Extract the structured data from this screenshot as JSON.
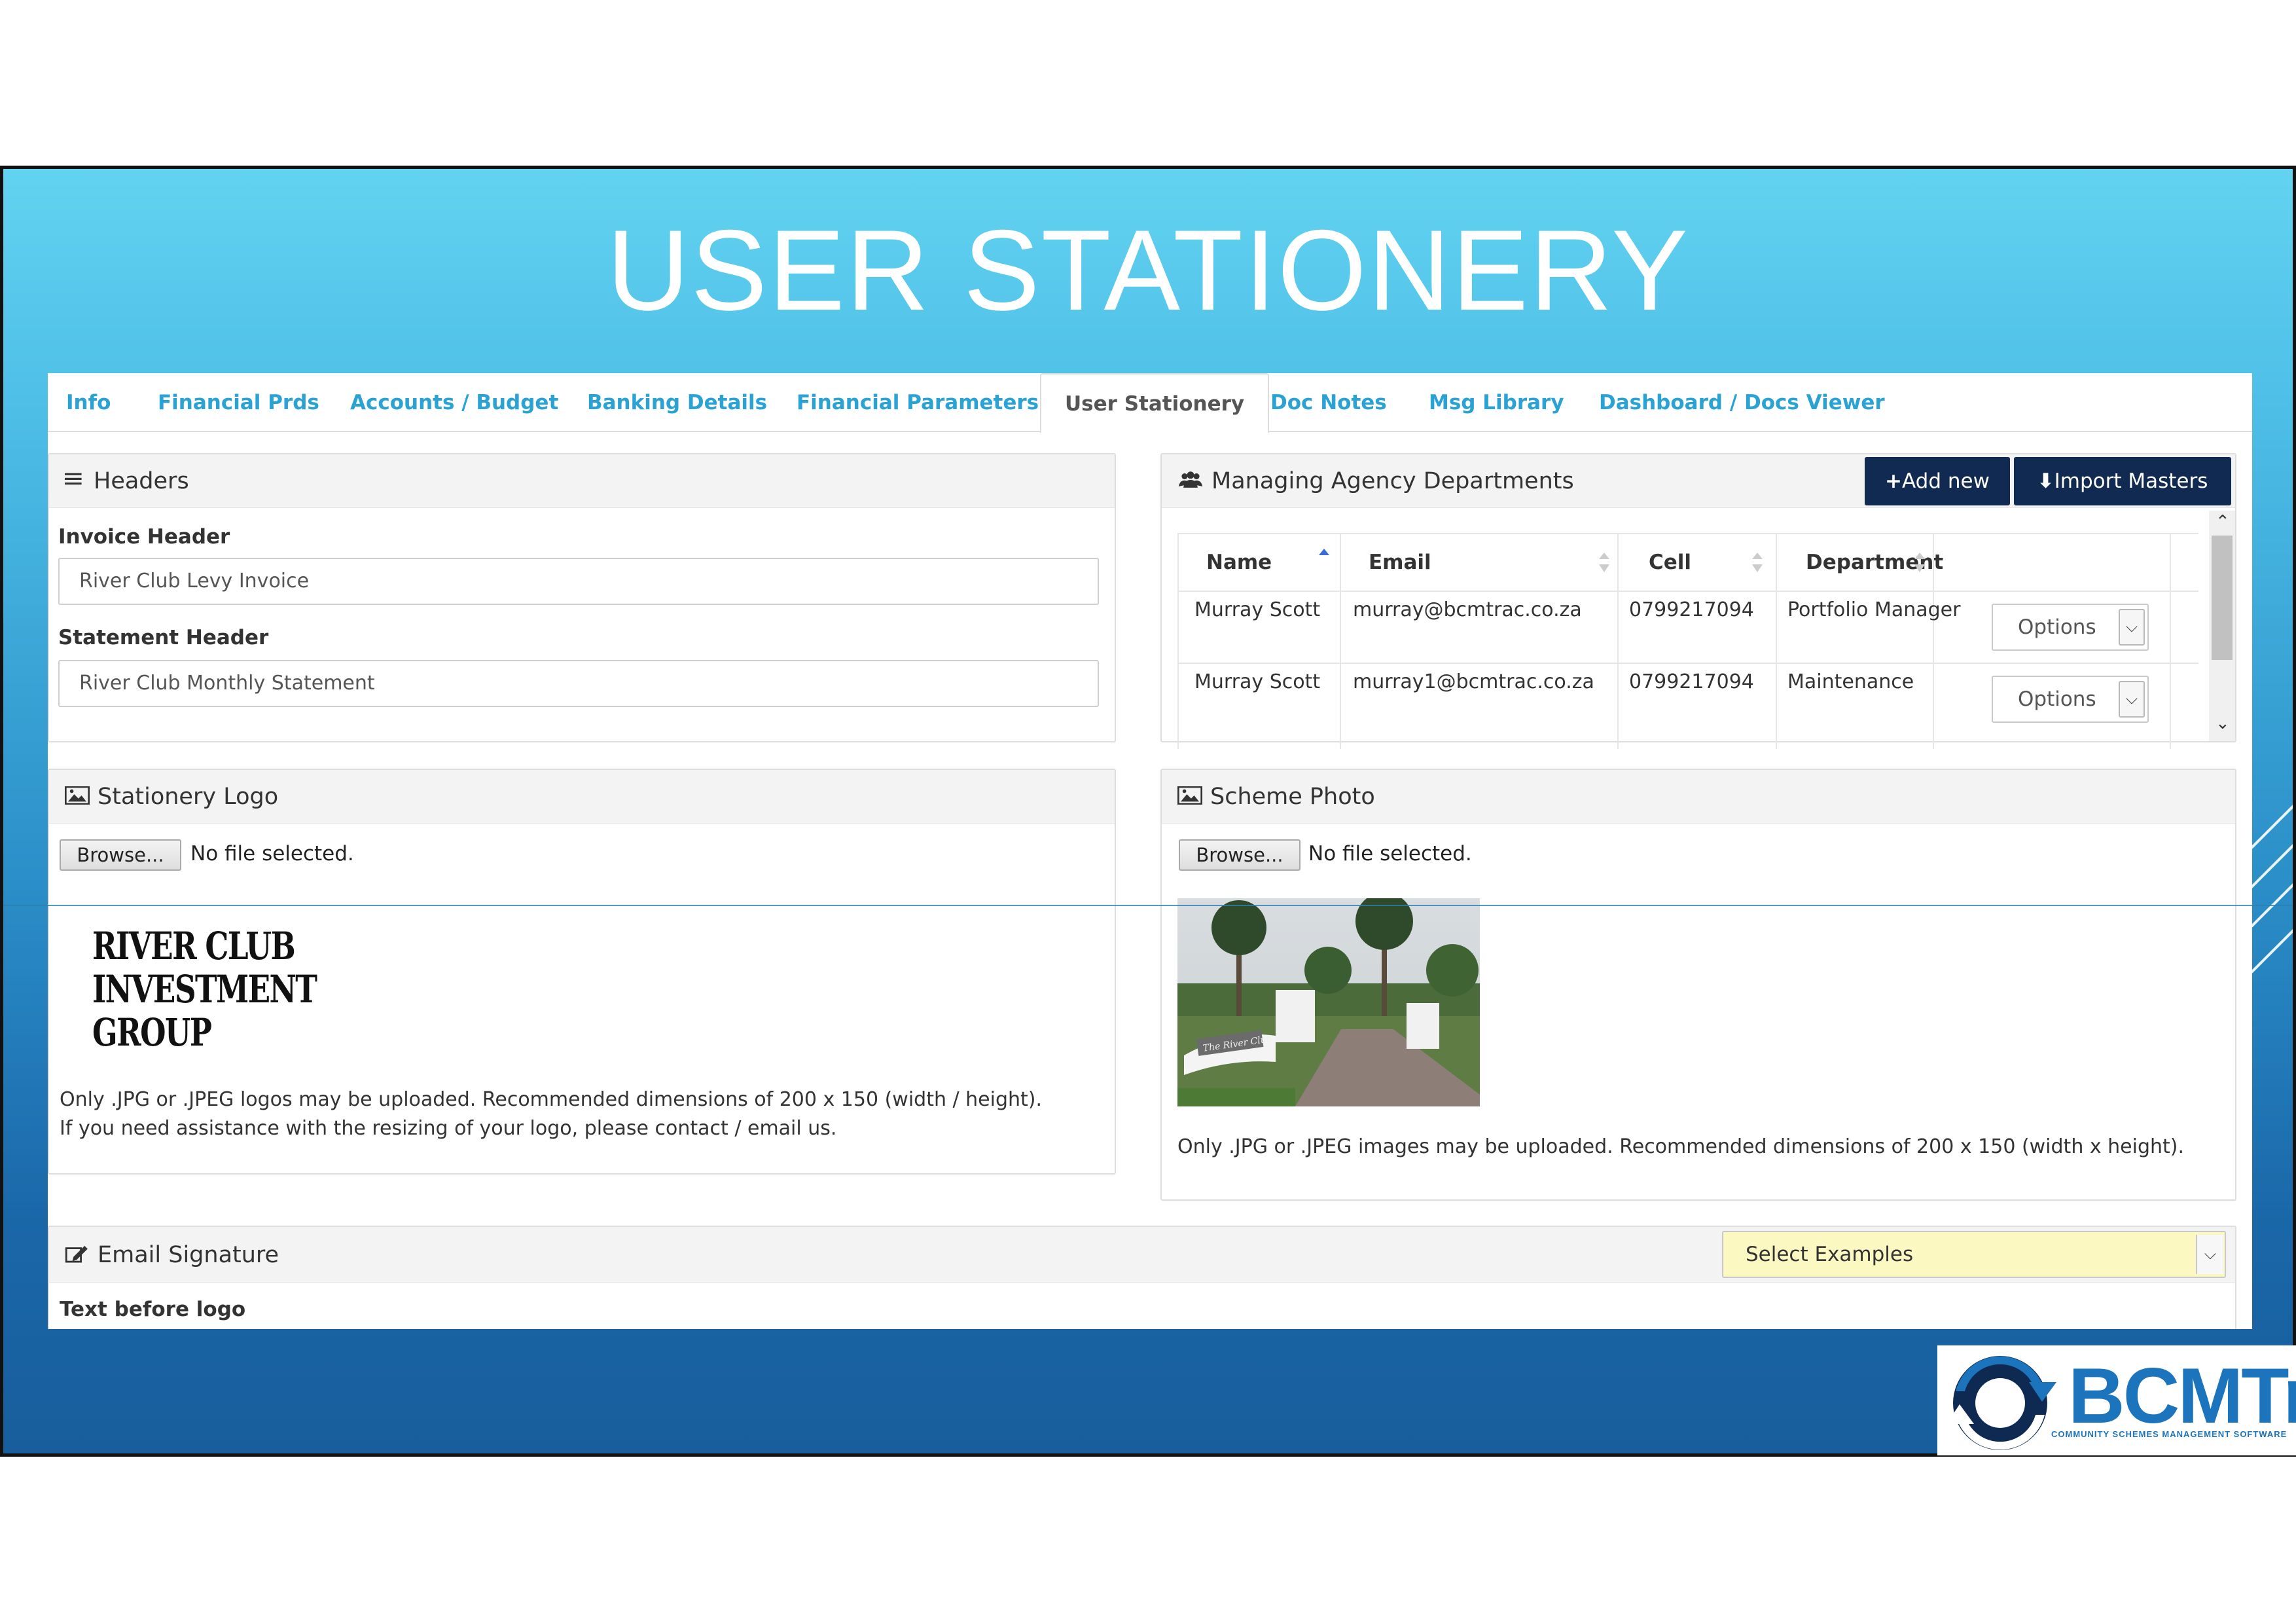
{
  "slide": {
    "title": "USER STATIONERY"
  },
  "tabs": [
    {
      "label": "Info"
    },
    {
      "label": "Financial Prds"
    },
    {
      "label": "Accounts / Budget"
    },
    {
      "label": "Banking Details"
    },
    {
      "label": "Financial Parameters"
    },
    {
      "label": "User Stationery",
      "active": true
    },
    {
      "label": "Doc Notes"
    },
    {
      "label": "Msg Library"
    },
    {
      "label": "Dashboard / Docs Viewer"
    }
  ],
  "headers": {
    "title": "Headers",
    "invoice_label": "Invoice Header",
    "invoice_value": "River Club Levy Invoice",
    "statement_label": "Statement Header",
    "statement_value": "River Club Monthly Statement"
  },
  "departments": {
    "title": "Managing Agency Departments",
    "add_new": "Add new",
    "import_masters": "Import Masters",
    "columns": [
      "Name",
      "Email",
      "Cell",
      "Department"
    ],
    "rows": [
      {
        "name": "Murray Scott",
        "email": "murray@bcmtrac.co.za",
        "cell": "0799217094",
        "department": "Portfolio Manager",
        "options": "Options"
      },
      {
        "name": "Murray Scott",
        "email": "murray1@bcmtrac.co.za",
        "cell": "0799217094",
        "department": "Maintenance",
        "options": "Options"
      }
    ]
  },
  "stationery_logo": {
    "title": "Stationery Logo",
    "browse": "Browse...",
    "no_file": "No file selected.",
    "logo_lines": [
      "RIVER CLUB",
      "INVESTMENT",
      "GROUP"
    ],
    "help_1": "Only .JPG or .JPEG logos may be uploaded. Recommended dimensions of 200 x 150 (width / height).",
    "help_2": "If you need assistance with the resizing of your logo, please contact / email us."
  },
  "scheme_photo": {
    "title": "Scheme Photo",
    "browse": "Browse...",
    "no_file": "No file selected.",
    "sign_text": "The River Club",
    "help": "Only .JPG or .JPEG images may be uploaded. Recommended dimensions of 200 x 150 (width x height)."
  },
  "email_signature": {
    "title": "Email Signature",
    "select_value": "Select Examples",
    "text_before_logo": "Text before logo"
  },
  "brand": {
    "name": "BCMTrac",
    "tagline": "COMMUNITY SCHEMES MANAGEMENT SOFTWARE"
  },
  "colors": {
    "tab_link": "#2aa2d4",
    "dark_button": "#102a52",
    "select_highlight": "#fcf8c2"
  }
}
